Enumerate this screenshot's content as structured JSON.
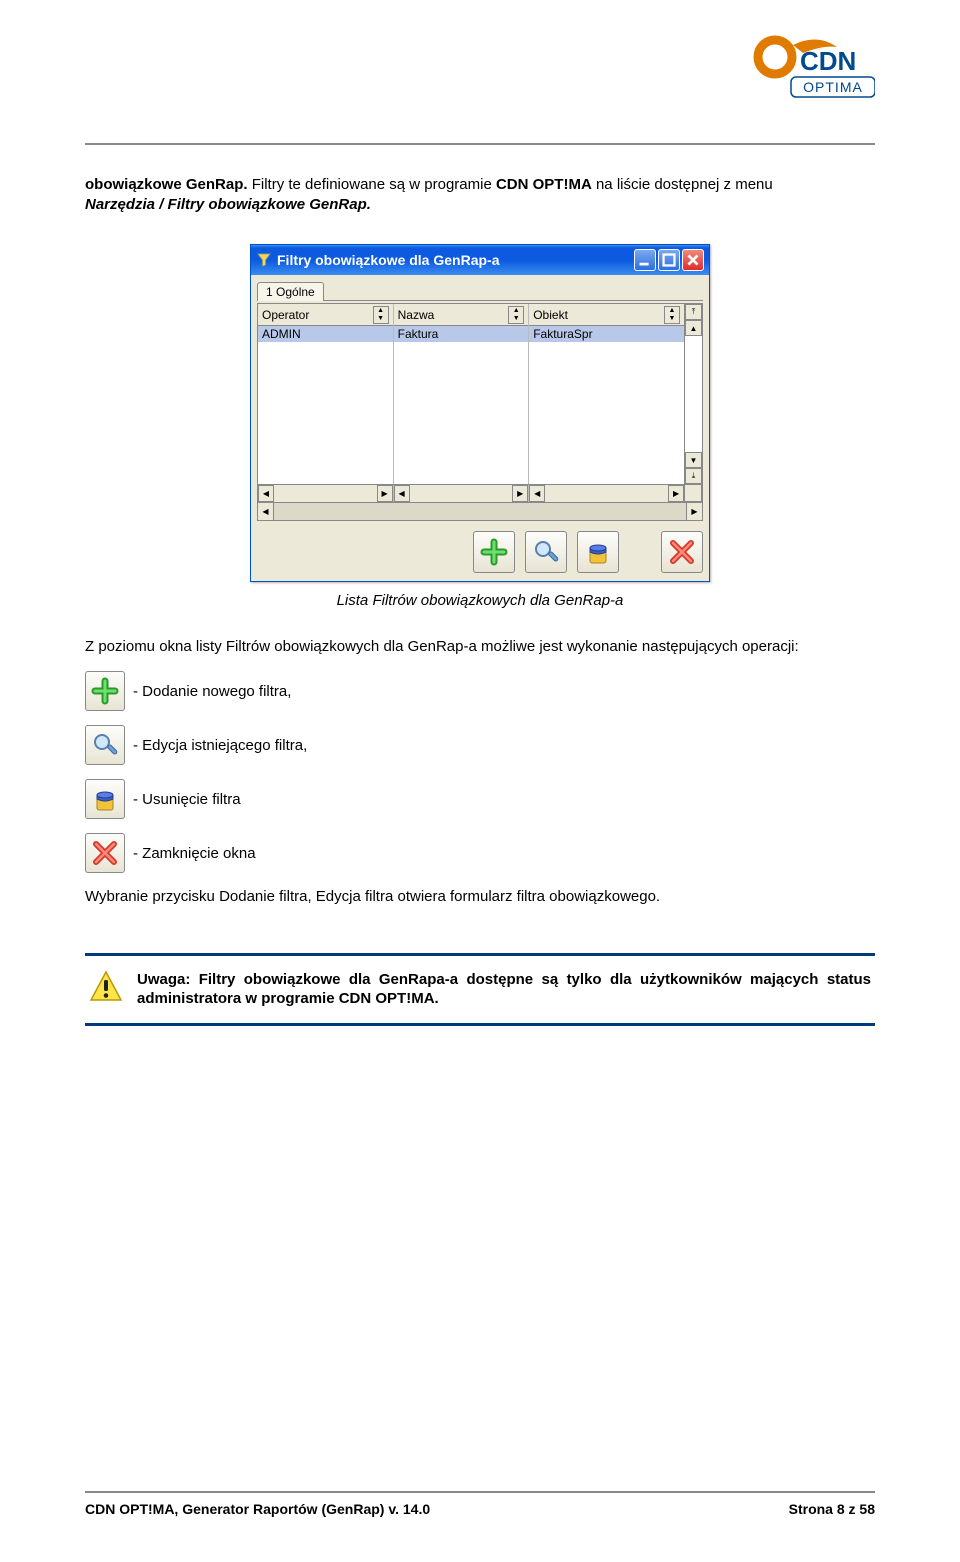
{
  "logo": {
    "top": "CDN",
    "bottom": "OPTIMA"
  },
  "intro": {
    "part1": "obowiązkowe GenRap.",
    "part2": " Filtry te definiowane są w programie ",
    "part3": "CDN OPT!MA",
    "part4": " na liście dostępnej z menu ",
    "part5": "Narzędzia / Filtry obowiązkowe GenRap."
  },
  "window": {
    "title": "Filtry obowiązkowe dla GenRap-a",
    "tab": "1 Ogólne",
    "columns": [
      {
        "header": "Operator",
        "value": "ADMIN"
      },
      {
        "header": "Nazwa",
        "value": "Faktura"
      },
      {
        "header": "Obiekt",
        "value": "FakturaSpr"
      }
    ],
    "caption": "Lista Filtrów obowiązkowych dla GenRap-a"
  },
  "description": "Z poziomu okna listy Filtrów obowiązkowych dla GenRap-a możliwe jest wykonanie następujących operacji:",
  "operations": [
    {
      "icon": "plus",
      "label": " - Dodanie nowego filtra,"
    },
    {
      "icon": "magnifier",
      "label": " - Edycja istniejącego filtra,"
    },
    {
      "icon": "bin",
      "label": " - Usunięcie filtra"
    },
    {
      "icon": "close",
      "label": " - Zamknięcie okna"
    }
  ],
  "after_list": "Wybranie przycisku Dodanie filtra, Edycja filtra otwiera formularz filtra obowiązkowego.",
  "alert": "Uwaga: Filtry obowiązkowe dla GenRapa-a dostępne są tylko dla użytkowników mających status administratora w programie CDN OPT!MA.",
  "footer": {
    "left": "CDN OPT!MA, Generator Raportów (GenRap) v. 14.0",
    "right": "Strona 8 z 58"
  }
}
